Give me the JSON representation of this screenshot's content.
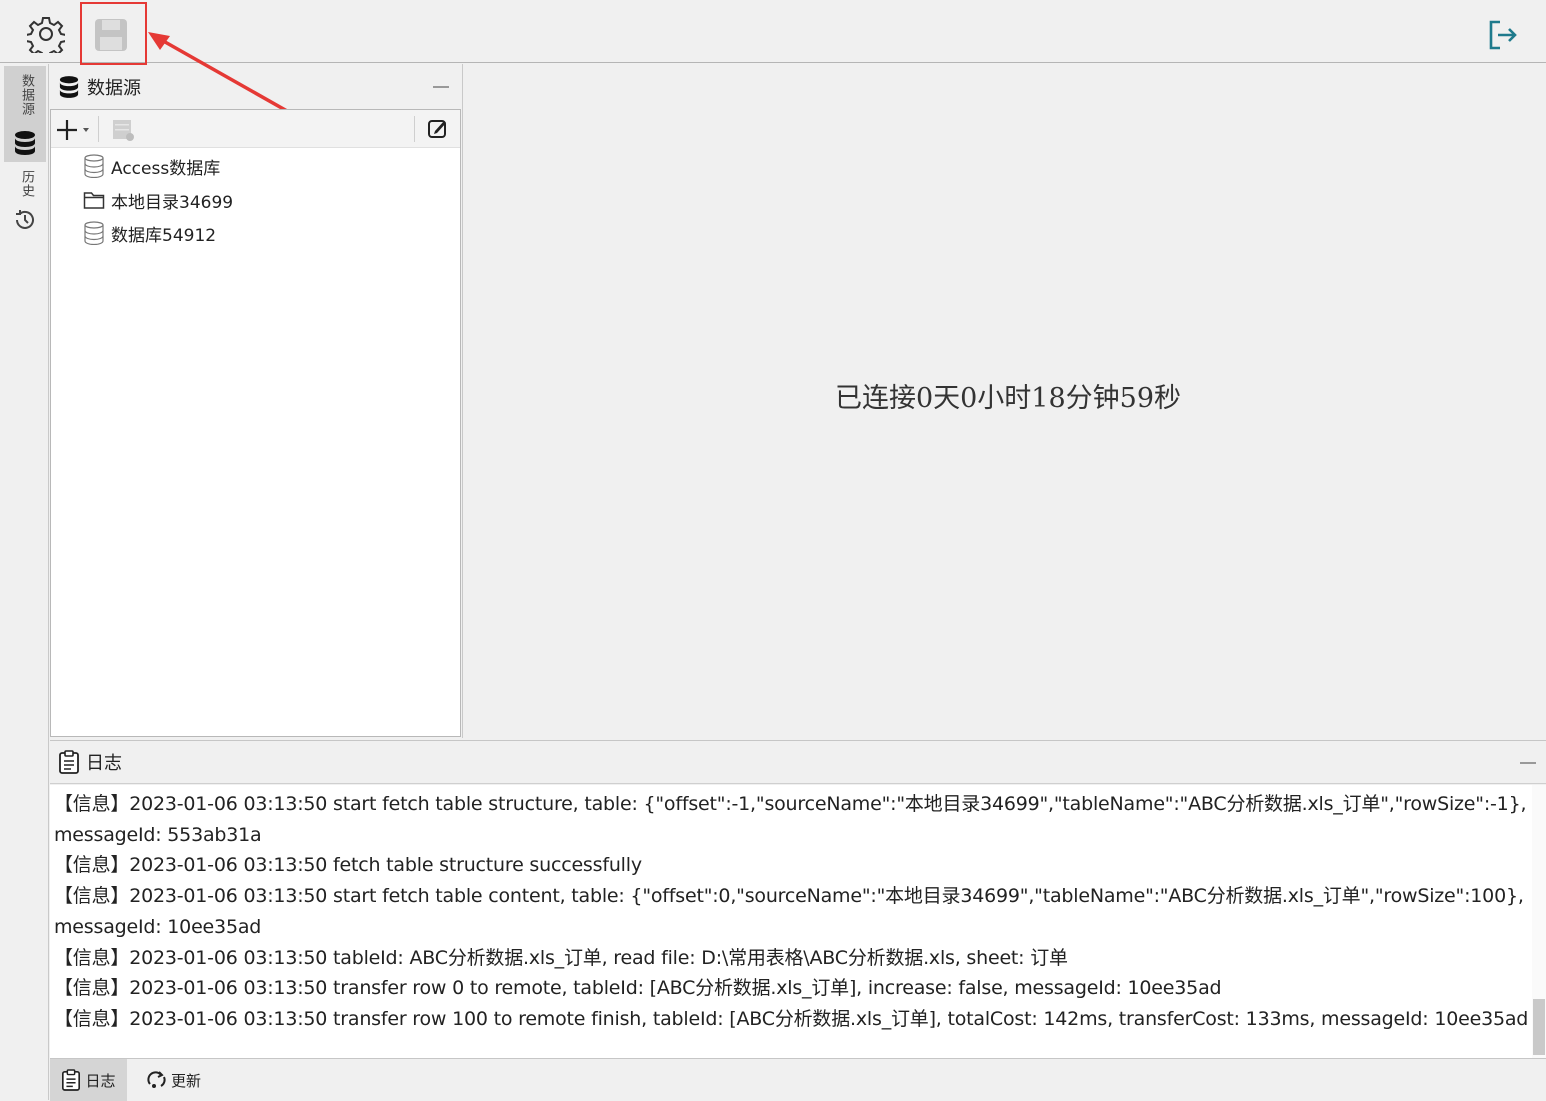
{
  "toolbar": {
    "settings_icon": "gear-icon",
    "save_icon": "floppy-disk-icon",
    "exit_icon": "logout-icon",
    "highlight_color": "#e53935"
  },
  "side_tabs": [
    {
      "label": "数据源",
      "icon": "database-icon"
    },
    {
      "label": "历史",
      "icon": "history-icon"
    }
  ],
  "datasource_panel": {
    "title": "数据源",
    "tools": {
      "add_icon": "plus-icon",
      "edit_icon": "edit-icon"
    },
    "items": [
      {
        "label": "Access数据库",
        "icon": "database-icon"
      },
      {
        "label": "本地目录34699",
        "icon": "folder-icon"
      },
      {
        "label": "数据库54912",
        "icon": "database-icon"
      }
    ]
  },
  "main": {
    "connection_status": "已连接0天0小时18分钟59秒"
  },
  "log_panel": {
    "title": "日志",
    "lines": [
      "【信息】2023-01-06 03:13:50 start fetch table structure, table: {\"offset\":-1,\"sourceName\":\"本地目录34699\",\"tableName\":\"ABC分析数据.xls_订单\",\"rowSize\":-1},",
      "messageId: 553ab31a",
      "【信息】2023-01-06 03:13:50 fetch table structure successfully",
      "【信息】2023-01-06 03:13:50 start fetch table content, table: {\"offset\":0,\"sourceName\":\"本地目录34699\",\"tableName\":\"ABC分析数据.xls_订单\",\"rowSize\":100},",
      "messageId: 10ee35ad",
      "【信息】2023-01-06 03:13:50 tableId: ABC分析数据.xls_订单, read file: D:\\常用表格\\ABC分析数据.xls, sheet: 订单",
      "【信息】2023-01-06 03:13:50 transfer row 0 to remote, tableId: [ABC分析数据.xls_订单], increase: false, messageId: 10ee35ad",
      "【信息】2023-01-06 03:13:50 transfer row 100 to remote finish, tableId: [ABC分析数据.xls_订单], totalCost: 142ms, transferCost: 133ms, messageId: 10ee35ad"
    ]
  },
  "bottom_tabs": [
    {
      "label": "日志",
      "icon": "clipboard-icon"
    },
    {
      "label": "更新",
      "icon": "update-icon"
    }
  ]
}
